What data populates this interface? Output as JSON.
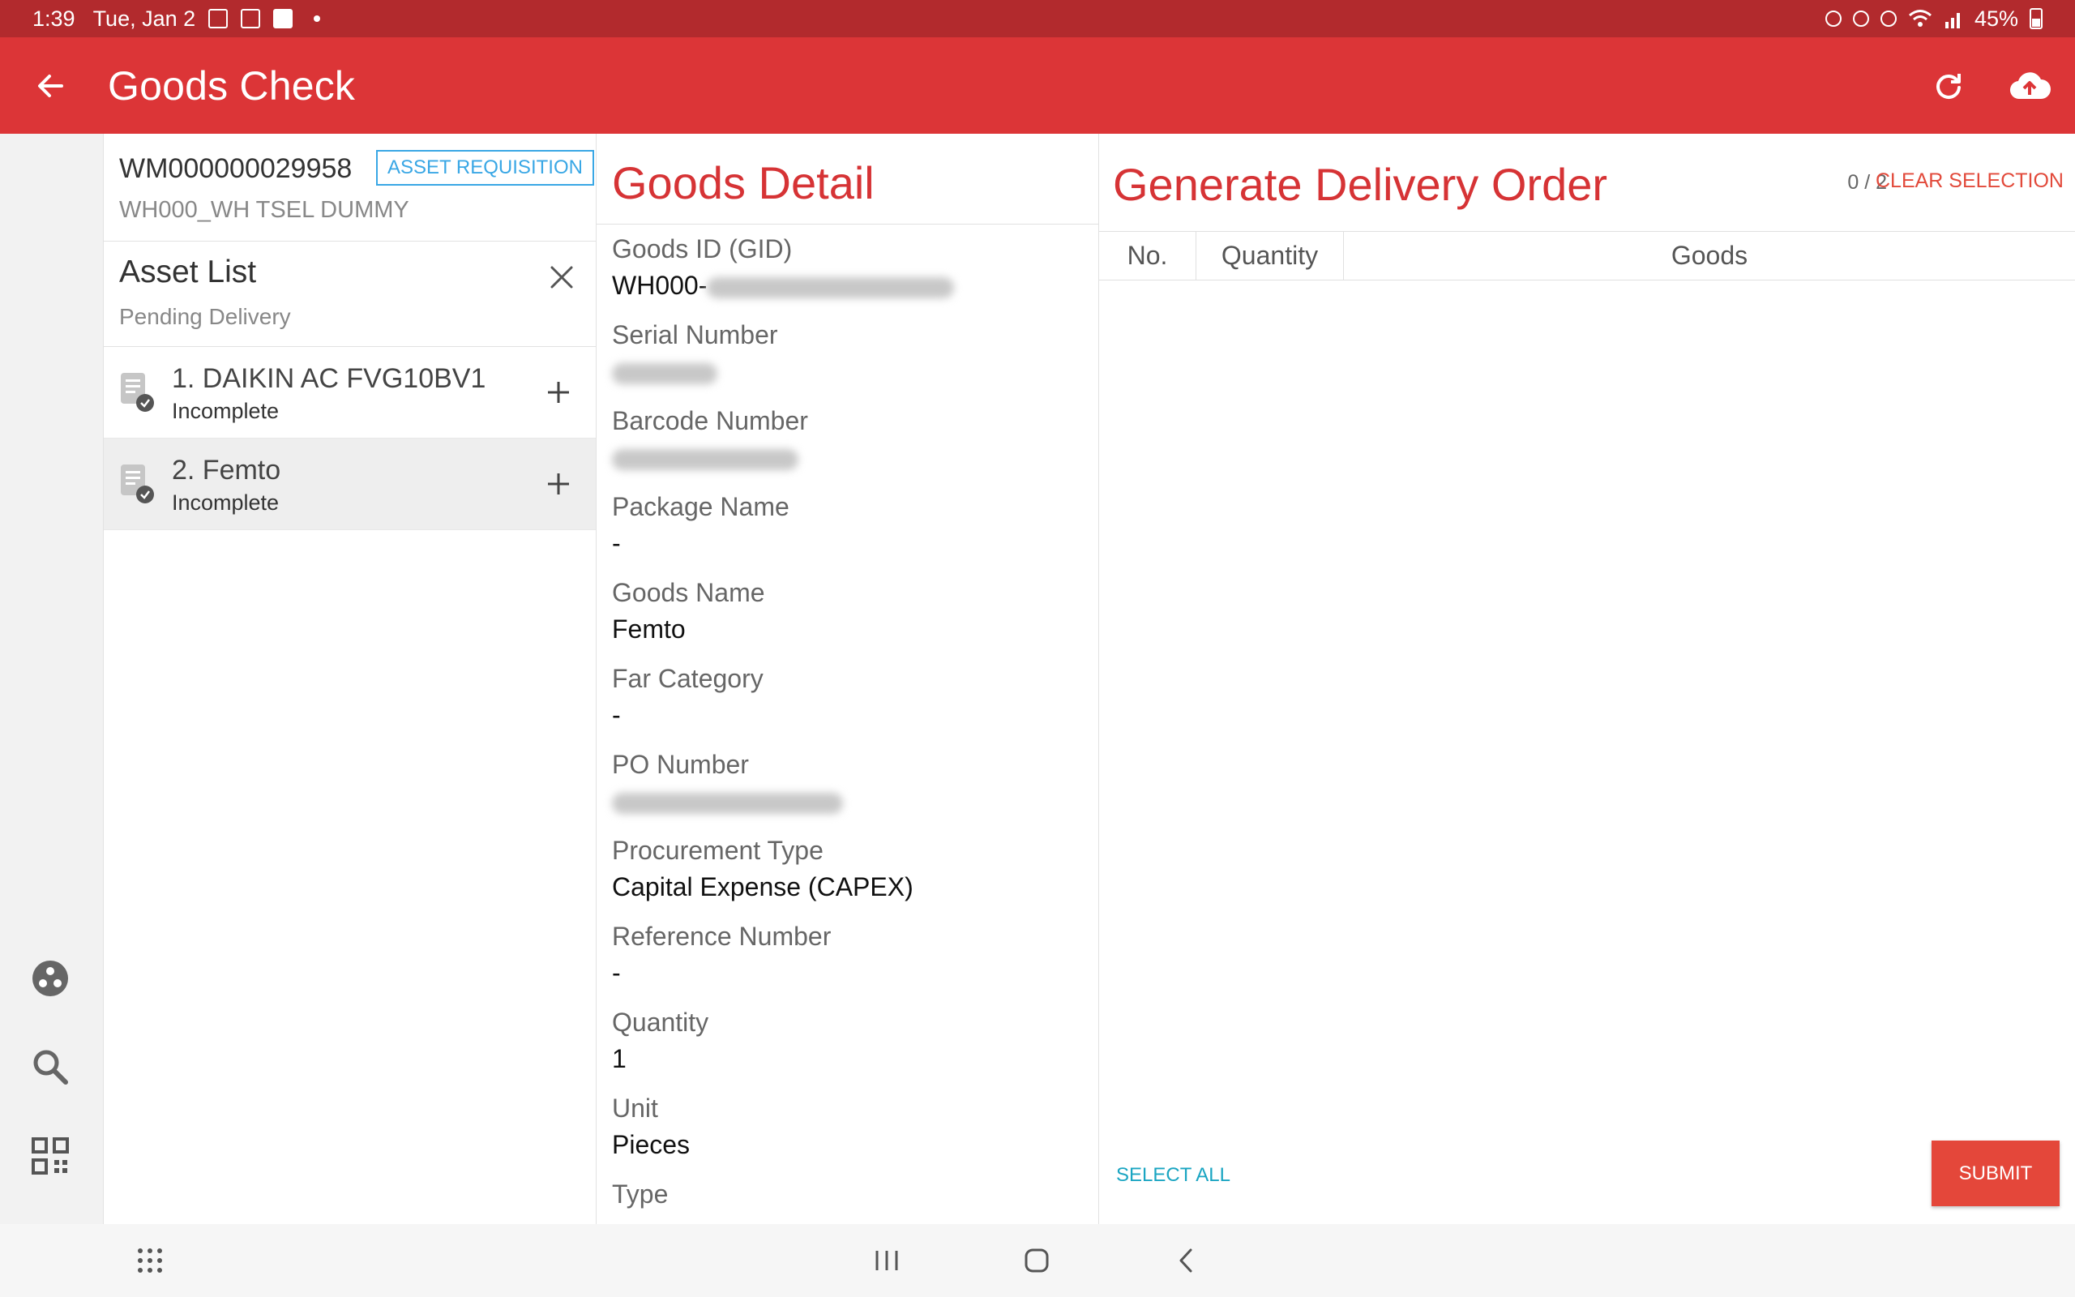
{
  "status_bar": {
    "time": "1:39",
    "date": "Tue, Jan 2",
    "battery": "45%",
    "icons": [
      "gallery-icon",
      "teams-icon",
      "check-icon",
      "alarm-icon",
      "mute-icon",
      "location-icon",
      "wifi-icon",
      "signal-icon",
      "battery-icon"
    ]
  },
  "app_bar": {
    "title": "Goods Check",
    "background": "#dc3537"
  },
  "requisition": {
    "code": "WM000000029958",
    "badge": "ASSET REQUISITION",
    "warehouse": "WH000_WH TSEL DUMMY"
  },
  "asset_list": {
    "title": "Asset List",
    "subtitle": "Pending Delivery",
    "items": [
      {
        "name": "1. DAIKIN AC FVG10BV1",
        "status": "Incomplete"
      },
      {
        "name": "2. Femto",
        "status": "Incomplete"
      }
    ]
  },
  "goods_detail": {
    "title": "Goods Detail",
    "fields": [
      {
        "label": "Goods ID (GID)",
        "value": "WH000-"
      },
      {
        "label": "Serial Number",
        "value": ""
      },
      {
        "label": "Barcode Number",
        "value": ""
      },
      {
        "label": "Package Name",
        "value": "-"
      },
      {
        "label": "Goods Name",
        "value": "Femto"
      },
      {
        "label": "Far Category",
        "value": "-"
      },
      {
        "label": "PO Number",
        "value": ""
      },
      {
        "label": "Procurement Type",
        "value": "Capital Expense (CAPEX)"
      },
      {
        "label": "Reference Number",
        "value": "-"
      },
      {
        "label": "Quantity",
        "value": "1"
      },
      {
        "label": "Unit",
        "value": "Pieces"
      },
      {
        "label": "Type",
        "value": ""
      }
    ]
  },
  "delivery_order": {
    "title": "Generate Delivery Order",
    "selection_count": "0 / 2",
    "clear_selection": "CLEAR SELECTION",
    "columns": [
      "No.",
      "Quantity",
      "Goods"
    ],
    "rows": [],
    "select_all": "SELECT ALL",
    "submit": "SUBMIT"
  },
  "colors": {
    "accent": "#d63335",
    "status_bar": "#b22a2d",
    "badge": "#39a7e5",
    "link": "#1aa5c2",
    "submit": "#e4473a"
  }
}
